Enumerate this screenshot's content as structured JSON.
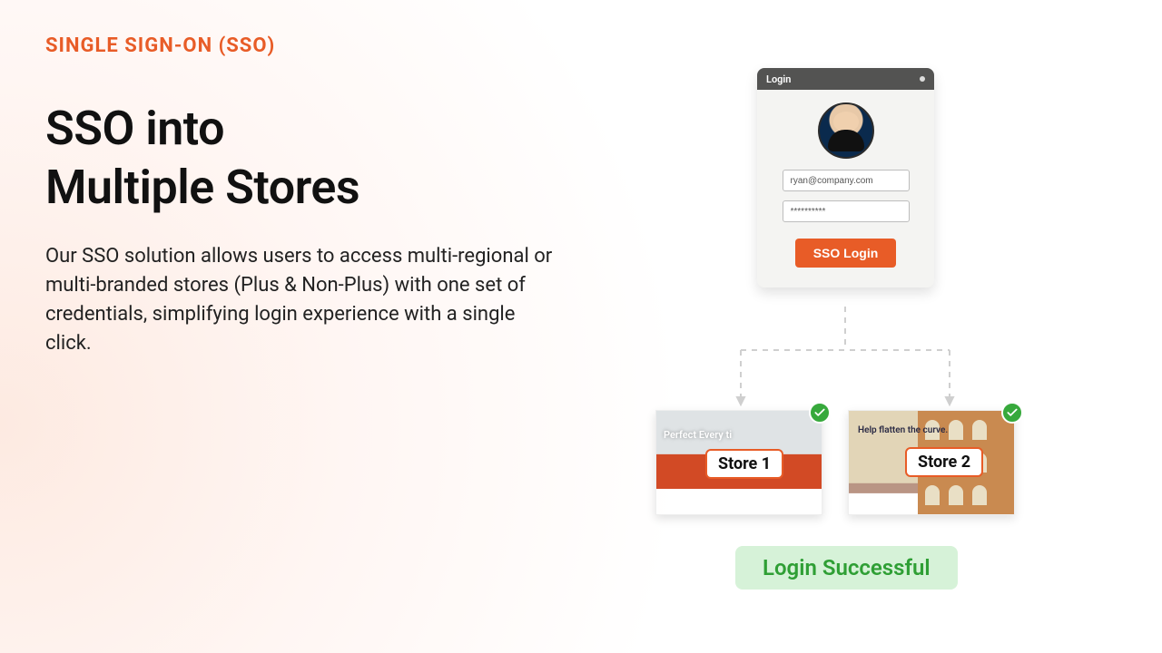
{
  "eyebrow": "SINGLE SIGN-ON  (SSO)",
  "headline_l1": "SSO into",
  "headline_l2": "Multiple Stores",
  "bodycopy": "Our SSO solution allows users to access multi-regional or multi-branded stores (Plus & Non-Plus) with one set of credentials, simplifying login experience with a single click.",
  "login": {
    "title": "Login",
    "email": "ryan@company.com",
    "password_mask": "**********",
    "button": "SSO Login"
  },
  "stores": [
    {
      "label": "Store 1",
      "hero_text": "Perfect Every ti"
    },
    {
      "label": "Store 2",
      "hero_text": "Help flatten the curve."
    }
  ],
  "success": "Login Successful"
}
